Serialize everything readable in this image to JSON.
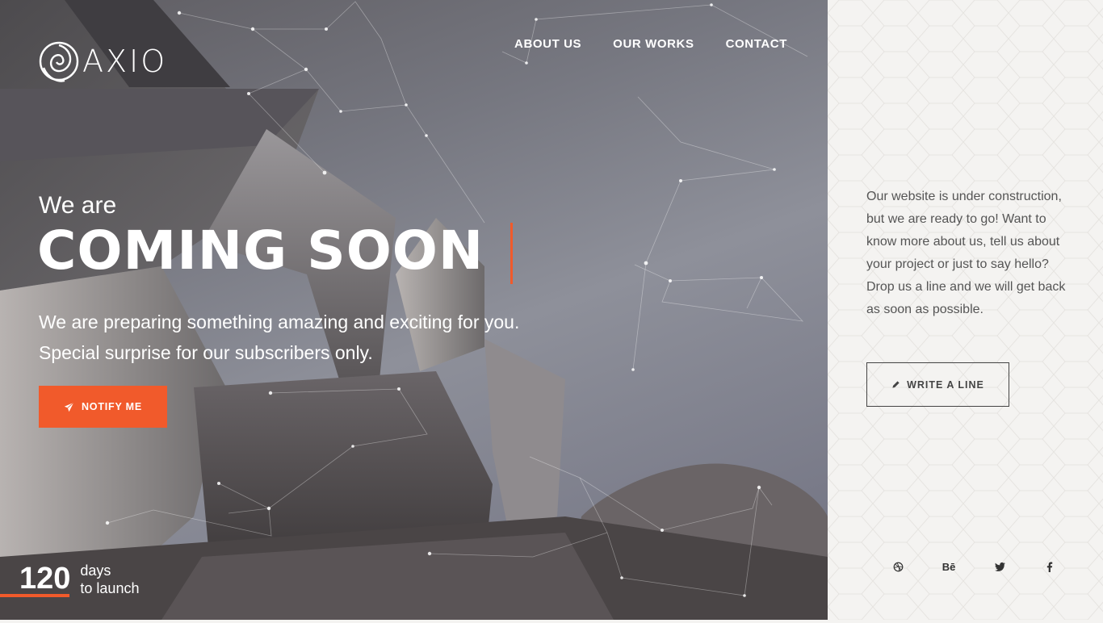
{
  "brand": {
    "name": "AXIO"
  },
  "nav": {
    "items": [
      {
        "label": "ABOUT US"
      },
      {
        "label": "OUR WORKS"
      },
      {
        "label": "CONTACT"
      }
    ]
  },
  "hero": {
    "intro": "We are",
    "headline": "COMING SOON",
    "subtitle": "We are preparing something amazing and exciting for you. Special surprise for our subscribers only.",
    "notify_label": "NOTIFY ME"
  },
  "countdown": {
    "number": "120",
    "unit": "days",
    "label": "to launch"
  },
  "side": {
    "text": "Our website is under construction, but we are ready to go! Want to know more about us, tell us about your project or just to say hello? Drop us a line and we will get back as soon as possible.",
    "write_label": "WRITE A LINE"
  },
  "socials": [
    {
      "icon": "dribbble-icon"
    },
    {
      "icon": "behance-icon",
      "label": "Bē"
    },
    {
      "icon": "twitter-icon"
    },
    {
      "icon": "facebook-icon"
    }
  ],
  "colors": {
    "accent": "#f15a2b",
    "side_bg": "#f4f3f1",
    "side_text": "#555555"
  }
}
